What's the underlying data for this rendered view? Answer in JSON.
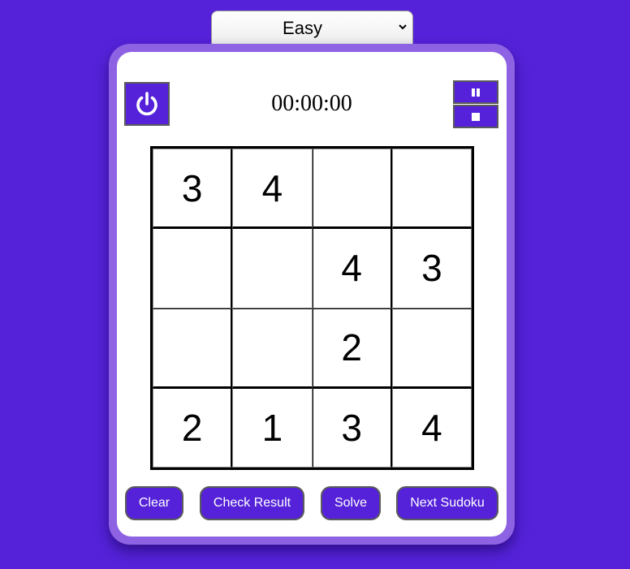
{
  "difficulty": {
    "selected": "Easy",
    "options": [
      "Easy"
    ]
  },
  "timer": {
    "display": "00:00:00"
  },
  "controls": {
    "power_icon": "power-icon",
    "pause_icon": "pause-icon",
    "stop_icon": "stop-icon"
  },
  "board": {
    "size": 4,
    "cells": [
      [
        "3",
        "4",
        "",
        ""
      ],
      [
        "",
        "",
        "4",
        "3"
      ],
      [
        "",
        "",
        "2",
        ""
      ],
      [
        "2",
        "1",
        "3",
        "4"
      ]
    ]
  },
  "actions": {
    "clear_label": "Clear",
    "check_label": "Check Result",
    "solve_label": "Solve",
    "next_label": "Next Sudoku"
  },
  "colors": {
    "background": "#5522d9",
    "accent": "#5522d9",
    "card_frame": "#8e63e3",
    "card": "#ffffff"
  }
}
